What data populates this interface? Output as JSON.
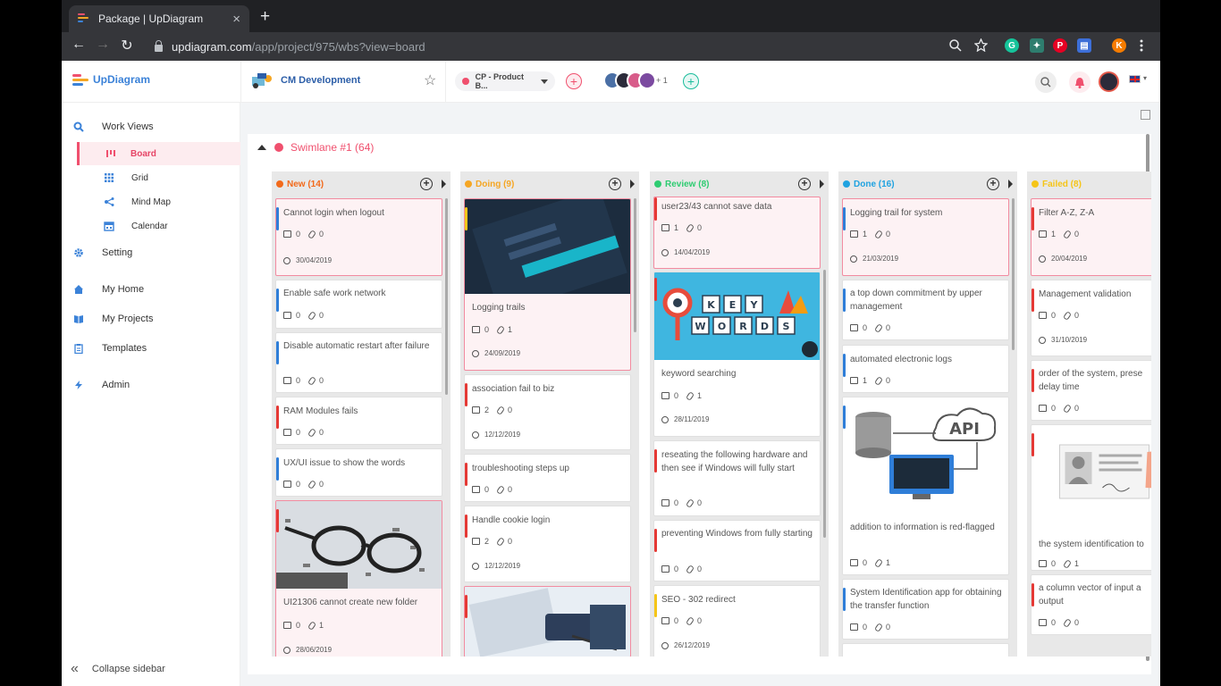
{
  "browser": {
    "tab_title": "Package | UpDiagram",
    "close": "×",
    "new_tab": "+",
    "url_host": "updiagram.com",
    "url_path": "/app/project/975/wbs?view=board",
    "nav_back": "←",
    "nav_forward": "→",
    "reload": "↻",
    "profile_initial": "K"
  },
  "header": {
    "logo": "UpDiagram",
    "project": "CM Development",
    "star": "☆",
    "package_select": "CP - Product B...",
    "extra_members": "+ 1",
    "plus": "+"
  },
  "sidebar": {
    "work_views": "Work Views",
    "board": "Board",
    "grid": "Grid",
    "mind_map": "Mind Map",
    "calendar": "Calendar",
    "setting": "Setting",
    "my_home": "My Home",
    "my_projects": "My Projects",
    "templates": "Templates",
    "admin": "Admin",
    "collapse": "Collapse sidebar",
    "collapse_glyph": "«"
  },
  "board": {
    "swimlane": "Swimlane #1 (64)",
    "columns": [
      {
        "name": "New (14)",
        "color": "#f26a1b",
        "cards": [
          {
            "title": "Cannot login when logout",
            "c": "0",
            "a": "0",
            "date": "30/04/2019",
            "bar": "#2f7ed8",
            "hl": true
          },
          {
            "title": "Enable safe work network",
            "c": "0",
            "a": "0",
            "bar": "#2f7ed8"
          },
          {
            "title": "Disable automatic restart after failure",
            "c": "0",
            "a": "0",
            "bar": "#2f7ed8"
          },
          {
            "title": "RAM Modules fails",
            "c": "0",
            "a": "0",
            "bar": "#e53935"
          },
          {
            "title": "UX/UI issue to show the words",
            "c": "0",
            "a": "0",
            "bar": "#2f7ed8"
          },
          {
            "title": "UI21306 cannot create new folder",
            "c": "0",
            "a": "1",
            "date": "28/06/2019",
            "bar": "#e53935",
            "hl": true
          }
        ]
      },
      {
        "name": "Doing (9)",
        "color": "#f5a623",
        "cards": [
          {
            "title": "Logging trails",
            "c": "0",
            "a": "1",
            "date": "24/09/2019",
            "bar": "#f5c518",
            "hl": true
          },
          {
            "title": "association fail to biz",
            "c": "2",
            "a": "0",
            "date": "12/12/2019",
            "bar": "#e53935"
          },
          {
            "title": "troubleshooting steps up",
            "c": "0",
            "a": "0",
            "bar": "#e53935"
          },
          {
            "title": "Handle cookie login",
            "c": "2",
            "a": "0",
            "date": "12/12/2019",
            "bar": "#e53935"
          },
          {
            "title": "",
            "c": "",
            "a": "",
            "bar": "#e53935",
            "hl": true
          }
        ]
      },
      {
        "name": "Review (8)",
        "color": "#2ecc71",
        "cards": [
          {
            "title": "user23/43 cannot save data",
            "c": "1",
            "a": "0",
            "date": "14/04/2019",
            "bar": "#e53935",
            "hl": true
          },
          {
            "title": "keyword searching",
            "c": "0",
            "a": "1",
            "date": "28/11/2019",
            "bar": "#e53935"
          },
          {
            "title": "reseating the following hardware and then see if Windows will fully start",
            "c": "0",
            "a": "0",
            "bar": "#e53935"
          },
          {
            "title": "preventing Windows from fully starting",
            "c": "0",
            "a": "0",
            "bar": "#e53935"
          },
          {
            "title": "SEO - 302 redirect",
            "c": "0",
            "a": "0",
            "date": "26/12/2019",
            "bar": "#f5c518"
          }
        ],
        "keywords": [
          "K",
          "E",
          "Y",
          "W",
          "O",
          "R",
          "D",
          "S"
        ]
      },
      {
        "name": "Done (16)",
        "color": "#1fa2e0",
        "cards": [
          {
            "title": "Logging trail for system",
            "c": "1",
            "a": "0",
            "date": "21/03/2019",
            "bar": "#2f7ed8",
            "hl": true
          },
          {
            "title": "a top down commitment by upper management",
            "c": "0",
            "a": "0",
            "bar": "#2f7ed8"
          },
          {
            "title": "automated electronic logs",
            "c": "1",
            "a": "0",
            "bar": "#2f7ed8"
          },
          {
            "title": "addition to information is red-flagged",
            "c": "0",
            "a": "1",
            "bar": "#2f7ed8"
          },
          {
            "title": "System Identification app for obtaining the transfer function",
            "c": "0",
            "a": "0",
            "bar": "#2f7ed8"
          }
        ],
        "api": "API"
      },
      {
        "name": "Failed (8)",
        "color": "#f5c518",
        "cards": [
          {
            "title": "Filter A-Z, Z-A",
            "c": "1",
            "a": "0",
            "date": "20/04/2019",
            "bar": "#e53935",
            "hl": true
          },
          {
            "title": "Management validation",
            "c": "0",
            "a": "0",
            "date": "31/10/2019",
            "bar": "#e53935"
          },
          {
            "title": "order of the system, prese delay time",
            "c": "0",
            "a": "0",
            "bar": "#e53935"
          },
          {
            "title": "the system identification to",
            "c": "0",
            "a": "1",
            "bar": "#e53935"
          },
          {
            "title": "a column vector of input a output",
            "c": "0",
            "a": "0",
            "bar": "#e53935"
          }
        ]
      }
    ]
  }
}
